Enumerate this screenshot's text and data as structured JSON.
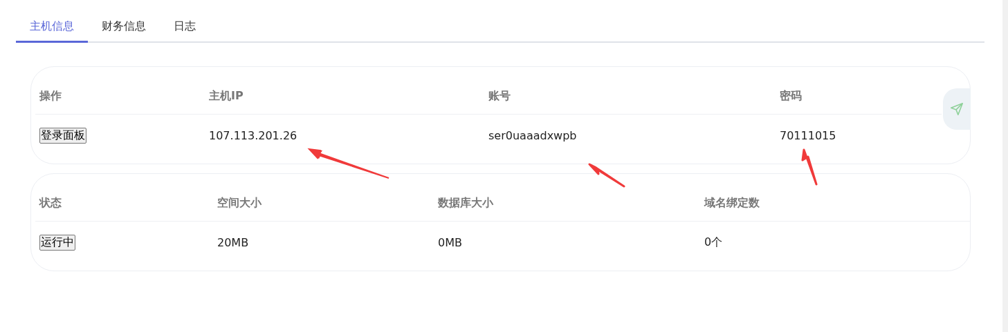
{
  "tabs": [
    {
      "label": "主机信息",
      "selected": true
    },
    {
      "label": "财务信息",
      "selected": false
    },
    {
      "label": "日志",
      "selected": false
    }
  ],
  "host_table": {
    "columns": [
      "操作",
      "主机IP",
      "账号",
      "密码"
    ],
    "row": [
      {
        "kind": "button",
        "text": "登录面板"
      },
      {
        "kind": "text",
        "text": "107.113.201.26"
      },
      {
        "kind": "text",
        "text": "ser0uaaadxwpb"
      },
      {
        "kind": "text",
        "text": "70111015"
      }
    ]
  },
  "status_table": {
    "columns": [
      "状态",
      "空间大小",
      "数据库大小",
      "域名绑定数"
    ],
    "row": [
      {
        "kind": "button",
        "text": "运行中"
      },
      {
        "kind": "text",
        "text": "20MB"
      },
      {
        "kind": "text",
        "text": "0MB"
      },
      {
        "kind": "text",
        "text": "0个"
      }
    ]
  }
}
